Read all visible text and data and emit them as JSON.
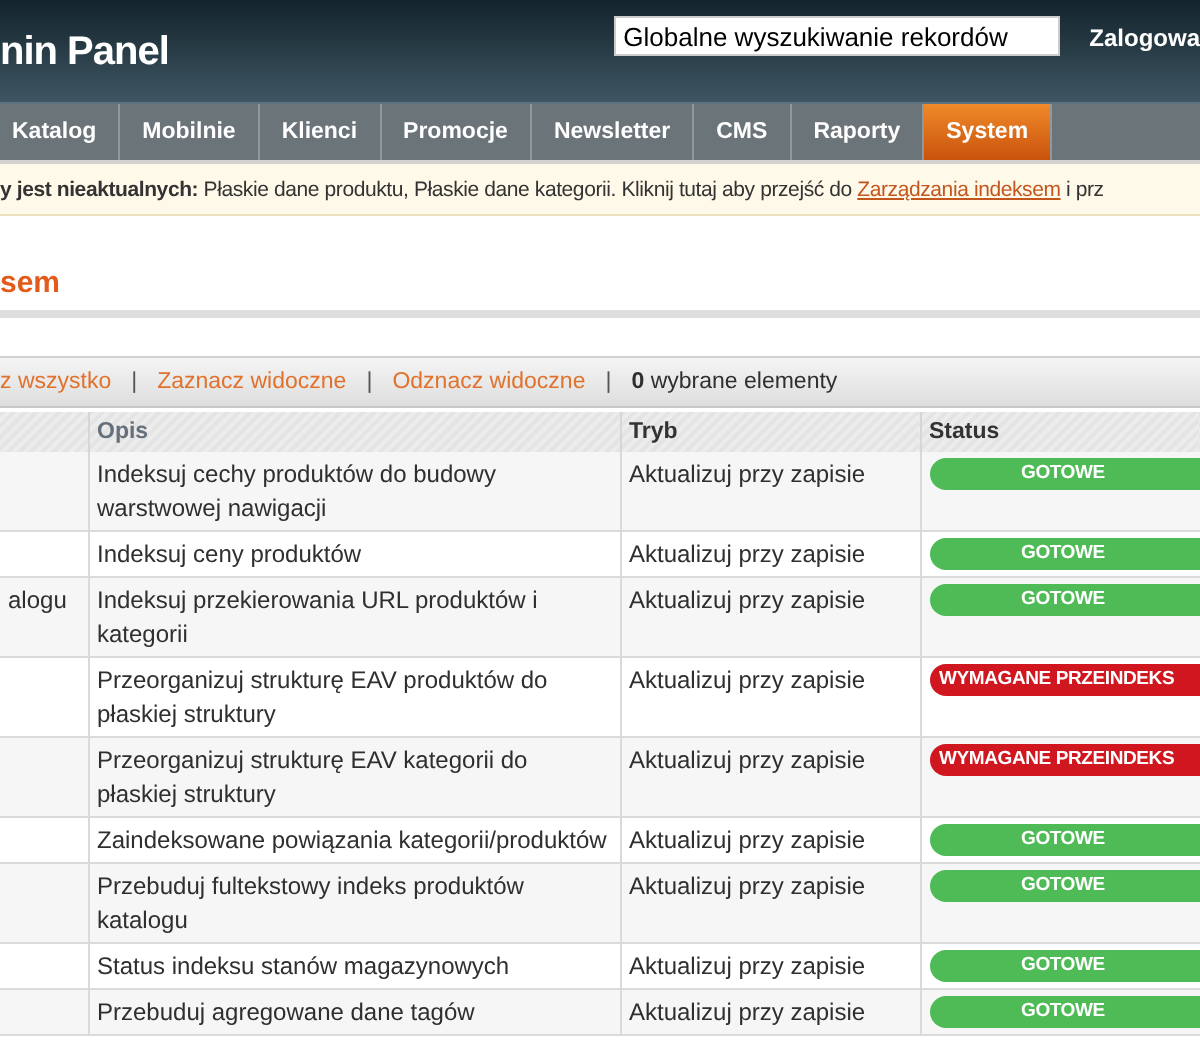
{
  "header": {
    "logo": "nin Panel",
    "search": {
      "value": "Globalne wyszukiwanie rekordów"
    },
    "user": "Zalogowa"
  },
  "nav": [
    {
      "label": "Katalog",
      "selected": false
    },
    {
      "label": "Mobilnie",
      "selected": false
    },
    {
      "label": "Klienci",
      "selected": false
    },
    {
      "label": "Promocje",
      "selected": false
    },
    {
      "label": "Newsletter",
      "selected": false
    },
    {
      "label": "CMS",
      "selected": false
    },
    {
      "label": "Raporty",
      "selected": false
    },
    {
      "label": "System",
      "selected": true
    }
  ],
  "notice": {
    "text": "**y jest nieaktualnych:** Płaskie dane produktu, Płaskie dane kategorii. Kliknij tutaj aby przejść do ",
    "link": "Zarządzania indeksem",
    "tail": " i prz"
  },
  "page_title": "sem",
  "massaction": {
    "links": [
      "z wszystko",
      "Zaznacz widoczne",
      "Odznacz widoczne"
    ],
    "separator": "|",
    "count": "0",
    "count_label": " wybrane elementy"
  },
  "table": {
    "columns": [
      "Opis",
      "Tryb",
      "Status"
    ],
    "rows": [
      {
        "description": "Indeksuj cechy produktów do budowy warstwowej nawigacji",
        "mode": "Aktualizuj przy zapisie",
        "status": {
          "kind": "ready",
          "label": "GOTOWE"
        }
      },
      {
        "description": "Indeksuj ceny produktów",
        "mode": "Aktualizuj przy zapisie",
        "status": {
          "kind": "ready",
          "label": "GOTOWE"
        }
      },
      {
        "column_1": "alogu",
        "description": "Indeksuj przekierowania URL produktów i kategorii",
        "mode": "Aktualizuj przy zapisie",
        "status": {
          "kind": "ready",
          "label": "GOTOWE"
        }
      },
      {
        "description": "Przeorganizuj strukturę EAV produktów do płaskiej struktury",
        "mode": "Aktualizuj przy zapisie",
        "status": {
          "kind": "required",
          "label": "WYMAGANE PRZEINDEKS"
        }
      },
      {
        "description": "Przeorganizuj strukturę EAV kategorii do płaskiej struktury",
        "mode": "Aktualizuj przy zapisie",
        "status": {
          "kind": "required",
          "label": "WYMAGANE PRZEINDEKS"
        }
      },
      {
        "description": "Zaindeksowane powiązania kategorii/produktów",
        "mode": "Aktualizuj przy zapisie",
        "status": {
          "kind": "ready",
          "label": "GOTOWE"
        }
      },
      {
        "description": "Przebuduj fultekstowy indeks produktów katalogu",
        "mode": "Aktualizuj przy zapisie",
        "status": {
          "kind": "ready",
          "label": "GOTOWE"
        }
      },
      {
        "description": "Status indeksu stanów magazynowych",
        "mode": "Aktualizuj przy zapisie",
        "status": {
          "kind": "ready",
          "label": "GOTOWE"
        }
      },
      {
        "description": "Przebuduj agregowane dane tagów",
        "mode": "Aktualizuj przy zapisie",
        "status": {
          "kind": "ready",
          "label": "GOTOWE"
        }
      }
    ]
  }
}
